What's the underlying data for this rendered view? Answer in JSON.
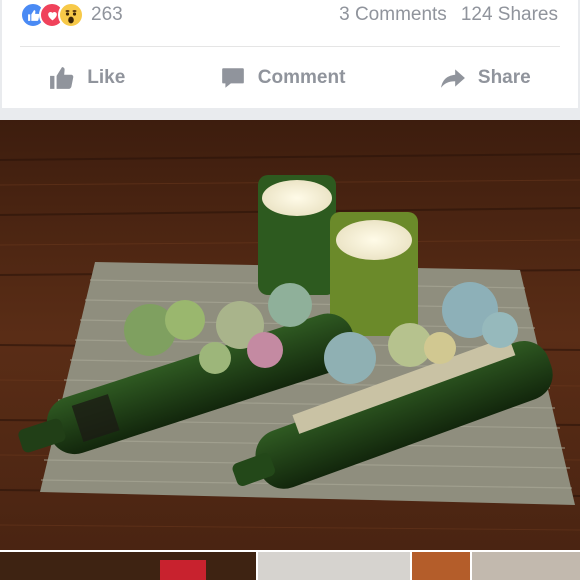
{
  "reactions": {
    "icons": [
      "like-icon",
      "love-icon",
      "wow-icon"
    ],
    "colors": {
      "like": "#4a8af4",
      "love": "#f0425b",
      "wow": "#f7c948"
    },
    "count": "263"
  },
  "stats": {
    "comments": "3 Comments",
    "shares": "124 Shares"
  },
  "actions": {
    "like": "Like",
    "comment": "Comment",
    "share": "Share"
  },
  "theme": {
    "muted_text": "#90949c",
    "divider": "#e5e5e5",
    "gap": "#e9ebee"
  }
}
